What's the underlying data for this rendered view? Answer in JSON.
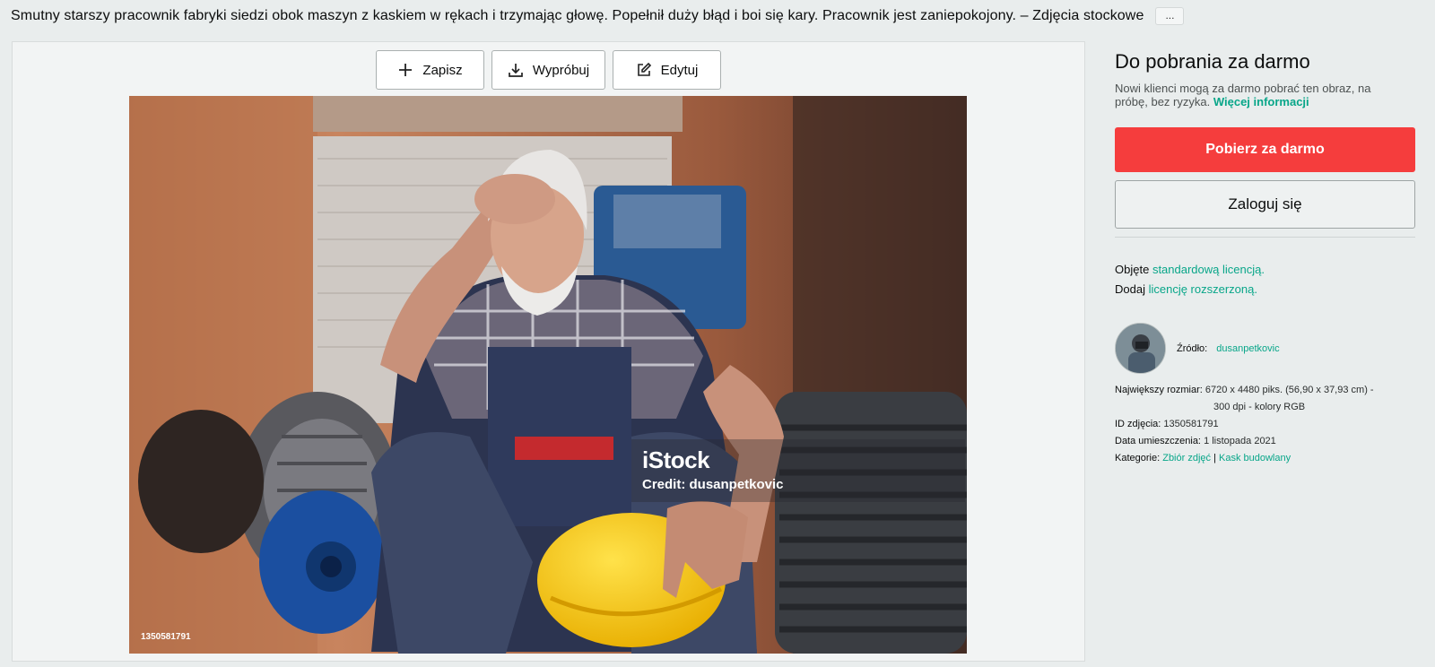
{
  "page": {
    "title": "Smutny starszy pracownik fabryki siedzi obok maszyn z kaskiem w rękach i trzymając głowę. Popełnił duży błąd i boi się kary. Pracownik jest zaniepokojony. – Zdjęcia stockowe",
    "more_label": "..."
  },
  "toolbar": {
    "save_label": "Zapisz",
    "try_label": "Wypróbuj",
    "edit_label": "Edytuj"
  },
  "image": {
    "watermark_logo": "iStock",
    "watermark_credit": "Credit: dusanpetkovic",
    "id_overlay": "1350581791"
  },
  "sidebar": {
    "heading": "Do pobrania za darmo",
    "note": "Nowi klienci mogą za darmo pobrać ten obraz, na próbę, bez ryzyka.",
    "more_info_link": "Więcej informacji",
    "primary_button": "Pobierz za darmo",
    "secondary_button": "Zaloguj się",
    "license_prefix": "Objęte",
    "license_link": "standardową licencją.",
    "extended_prefix": "Dodaj",
    "extended_link": "licencję rozszerzoną.",
    "source_label": "Źródło:",
    "source_name": "dusanpetkovic",
    "max_size_label": "Największy rozmiar:",
    "max_size_value": "6720 x 4480 piks. (56,90 x 37,93 cm) -",
    "max_size_value_2": "300 dpi - kolory RGB",
    "photo_id_label": "ID zdjęcia:",
    "photo_id_value": "1350581791",
    "upload_date_label": "Data umieszczenia:",
    "upload_date_value": "1 listopada 2021",
    "categories_label": "Kategorie:",
    "category_1": "Zbiór zdjęć",
    "category_sep": "|",
    "category_2": "Kask budowlany"
  },
  "colors": {
    "accent_green": "#08a689",
    "primary_red": "#f53d3d",
    "background": "#e9eded"
  },
  "icons": {
    "save": "plus-icon",
    "try": "download-icon",
    "edit": "edit-icon"
  }
}
